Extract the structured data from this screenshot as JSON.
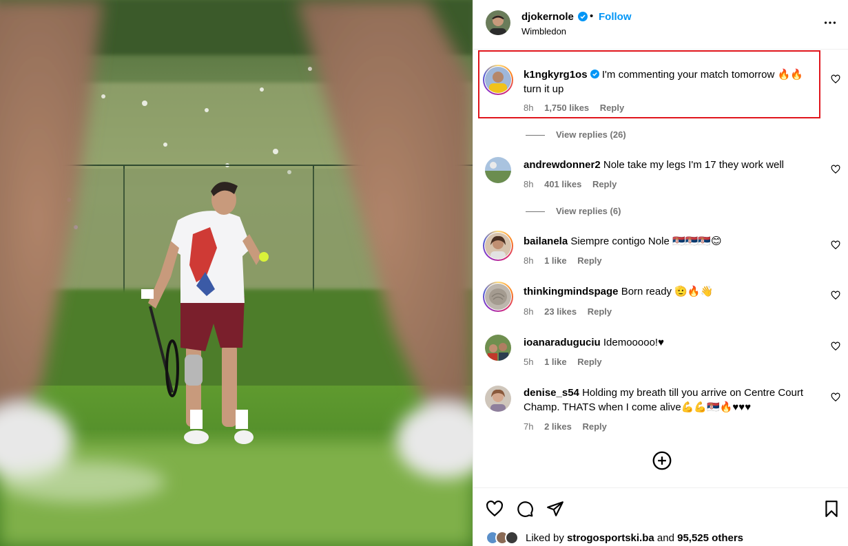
{
  "post": {
    "author": "djokernole",
    "location": "Wimbledon",
    "follow_label": "Follow",
    "dot": "•"
  },
  "comments": [
    {
      "user": "k1ngkyrg1os",
      "verified": true,
      "text": "I'm commenting your match tomorrow 🔥🔥 turn it up",
      "time": "8h",
      "likes": "1,750 likes",
      "reply": "Reply",
      "view_replies": "View replies (26)"
    },
    {
      "user": "andrewdonner2",
      "text": "Nole take my legs I'm 17 they work well",
      "time": "8h",
      "likes": "401 likes",
      "reply": "Reply",
      "view_replies": "View replies (6)"
    },
    {
      "user": "bailanela",
      "text": "Siempre contigo Nole 🇷🇸🇷🇸🇷🇸😊",
      "time": "8h",
      "likes": "1 like",
      "reply": "Reply"
    },
    {
      "user": "thinkingmindspage",
      "text": "Born ready 🫡🔥👋",
      "time": "8h",
      "likes": "23 likes",
      "reply": "Reply"
    },
    {
      "user": "ioanaraduguciu",
      "text": "Idemooooo!♥",
      "time": "5h",
      "likes": "1 like",
      "reply": "Reply"
    },
    {
      "user": "denise_s54",
      "text": "Holding my breath till you arrive on Centre Court Champ. THATS when I come alive💪💪🇷🇸🔥♥♥♥",
      "time": "7h",
      "likes": "2 likes",
      "reply": "Reply"
    }
  ],
  "likes_summary": {
    "prefix": "Liked by ",
    "user": "strogosportski.ba",
    "middle": " and ",
    "others": "95,525 others"
  },
  "colors": {
    "follow": "#0095f6",
    "highlight": "#e0141b",
    "muted": "#737373"
  }
}
